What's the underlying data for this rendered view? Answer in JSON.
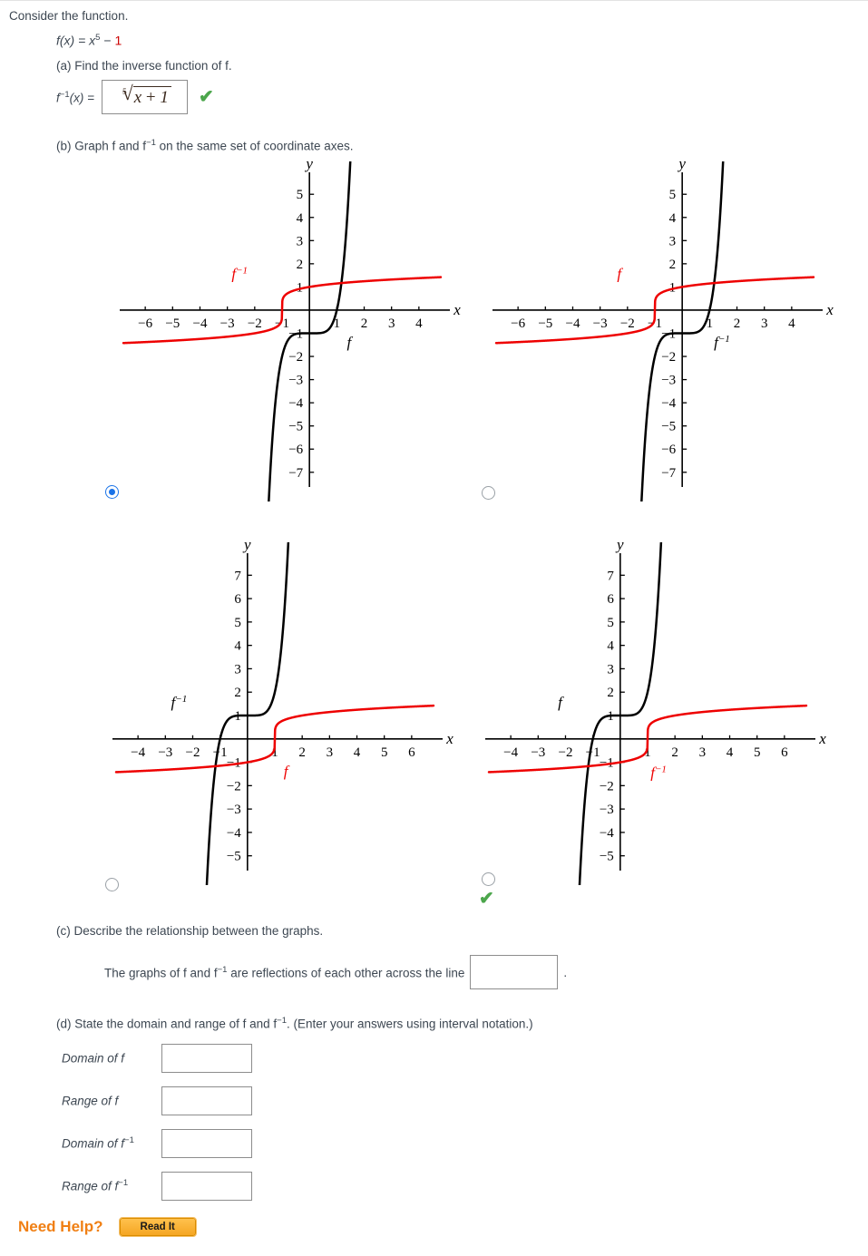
{
  "prompt": "Consider the function.",
  "equation": {
    "fx": "f(x) = x",
    "exp": "5",
    "minus": " − ",
    "const": "1"
  },
  "part_a": {
    "label": "(a) Find the inverse function of f.",
    "lhs": "f",
    "lhs_sup": "−1",
    "lhs_tail": "(x) =",
    "answer": {
      "index": "5",
      "radicand": "x",
      "plus": " + ",
      "one": "1"
    },
    "correct_mark": "✔"
  },
  "part_b": {
    "label_pre": "(b) Graph f and  f",
    "label_sup": "−1",
    "label_post": " on the same set of coordinate axes."
  },
  "part_c": {
    "label": "(c) Describe the relationship between the graphs.",
    "sentence_pre": "The graphs of f and  f",
    "sentence_sup": "−1",
    "sentence_mid": " are reflections of each other across the line",
    "sentence_end": ".",
    "input_value": ""
  },
  "part_d": {
    "label_pre": "(d) State the domain and range of f and  f",
    "label_sup": "−1",
    "label_post": ".  (Enter your answers using interval notation.)",
    "rows": [
      {
        "label": "Domain of f",
        "sup": "",
        "value": ""
      },
      {
        "label": "Range of f",
        "sup": "",
        "value": ""
      },
      {
        "label": "Domain of f",
        "sup": "−1",
        "value": ""
      },
      {
        "label": "Range of f",
        "sup": "−1",
        "value": ""
      }
    ]
  },
  "help": {
    "label": "Need Help?",
    "button": "Read It"
  },
  "colors": {
    "curve_f": "#000000",
    "curve_finv": "#ee0000",
    "accent_orange": "#f07f13",
    "check_green": "#4ca64c",
    "radio_blue": "#1a73e8",
    "text": "#3d4752"
  },
  "chart_data": [
    {
      "id": "option-1",
      "type": "line",
      "title": "",
      "xlabel": "x",
      "ylabel": "y",
      "xlim": [
        -6.8,
        4.8
      ],
      "ylim": [
        -7.4,
        5.4
      ],
      "xticks": [
        -6,
        -5,
        -4,
        -3,
        -2,
        -1,
        1,
        2,
        3,
        4
      ],
      "yticks": [
        5,
        4,
        3,
        2,
        1,
        -1,
        -2,
        -3,
        -4,
        -5,
        -6,
        -7
      ],
      "grid": false,
      "selected": true,
      "correct": false,
      "series": [
        {
          "name": "f",
          "color": "#000000",
          "expr": "x^5 - 1",
          "label": "f",
          "label_pos": [
            1.45,
            -1.6
          ]
        },
        {
          "name": "f-inverse",
          "color": "#ee0000",
          "expr": "fifth-root(x + 1)",
          "label": "f⁻¹",
          "label_pos": [
            -2.55,
            1.35
          ]
        }
      ]
    },
    {
      "id": "option-2",
      "type": "line",
      "title": "",
      "xlabel": "x",
      "ylabel": "y",
      "xlim": [
        -6.8,
        4.8
      ],
      "ylim": [
        -7.4,
        5.4
      ],
      "xticks": [
        -6,
        -5,
        -4,
        -3,
        -2,
        -1,
        1,
        2,
        3,
        4
      ],
      "yticks": [
        5,
        4,
        3,
        2,
        1,
        -1,
        -2,
        -3,
        -4,
        -5,
        -6,
        -7
      ],
      "grid": false,
      "selected": false,
      "correct": false,
      "series": [
        {
          "name": "f-inverse",
          "color": "#000000",
          "expr": "x^5 - 1",
          "label": "f⁻¹",
          "label_pos": [
            1.45,
            -1.6
          ]
        },
        {
          "name": "f",
          "color": "#ee0000",
          "expr": "fifth-root(x + 1)",
          "label": "f",
          "label_pos": [
            -2.3,
            1.35
          ]
        }
      ]
    },
    {
      "id": "option-3",
      "type": "line",
      "title": "",
      "xlabel": "x",
      "ylabel": "y",
      "xlim": [
        -4.8,
        6.8
      ],
      "ylim": [
        -5.4,
        7.4
      ],
      "xticks": [
        -4,
        -3,
        -2,
        -1,
        1,
        2,
        3,
        4,
        5,
        6
      ],
      "yticks": [
        7,
        6,
        5,
        4,
        3,
        2,
        1,
        -1,
        -2,
        -3,
        -4,
        -5
      ],
      "grid": false,
      "selected": false,
      "correct": false,
      "series": [
        {
          "name": "f-inverse",
          "color": "#000000",
          "expr": "x^5 + 1",
          "label": "f⁻¹",
          "label_pos": [
            -2.5,
            1.35
          ]
        },
        {
          "name": "f",
          "color": "#ee0000",
          "expr": "fifth-root(x - 1)",
          "label": "f",
          "label_pos": [
            1.4,
            -1.6
          ]
        }
      ]
    },
    {
      "id": "option-4",
      "type": "line",
      "title": "",
      "xlabel": "x",
      "ylabel": "y",
      "xlim": [
        -4.8,
        6.8
      ],
      "ylim": [
        -5.4,
        7.4
      ],
      "xticks": [
        -4,
        -3,
        -2,
        -1,
        1,
        2,
        3,
        4,
        5,
        6
      ],
      "yticks": [
        7,
        6,
        5,
        4,
        3,
        2,
        1,
        -1,
        -2,
        -3,
        -4,
        -5
      ],
      "grid": false,
      "selected": false,
      "correct": true,
      "series": [
        {
          "name": "f",
          "color": "#000000",
          "expr": "x^5 + 1",
          "label": "f",
          "label_pos": [
            -2.2,
            1.35
          ]
        },
        {
          "name": "f-inverse",
          "color": "#ee0000",
          "expr": "fifth-root(x - 1)",
          "label": "f⁻¹",
          "label_pos": [
            1.4,
            -1.65
          ]
        }
      ]
    }
  ]
}
